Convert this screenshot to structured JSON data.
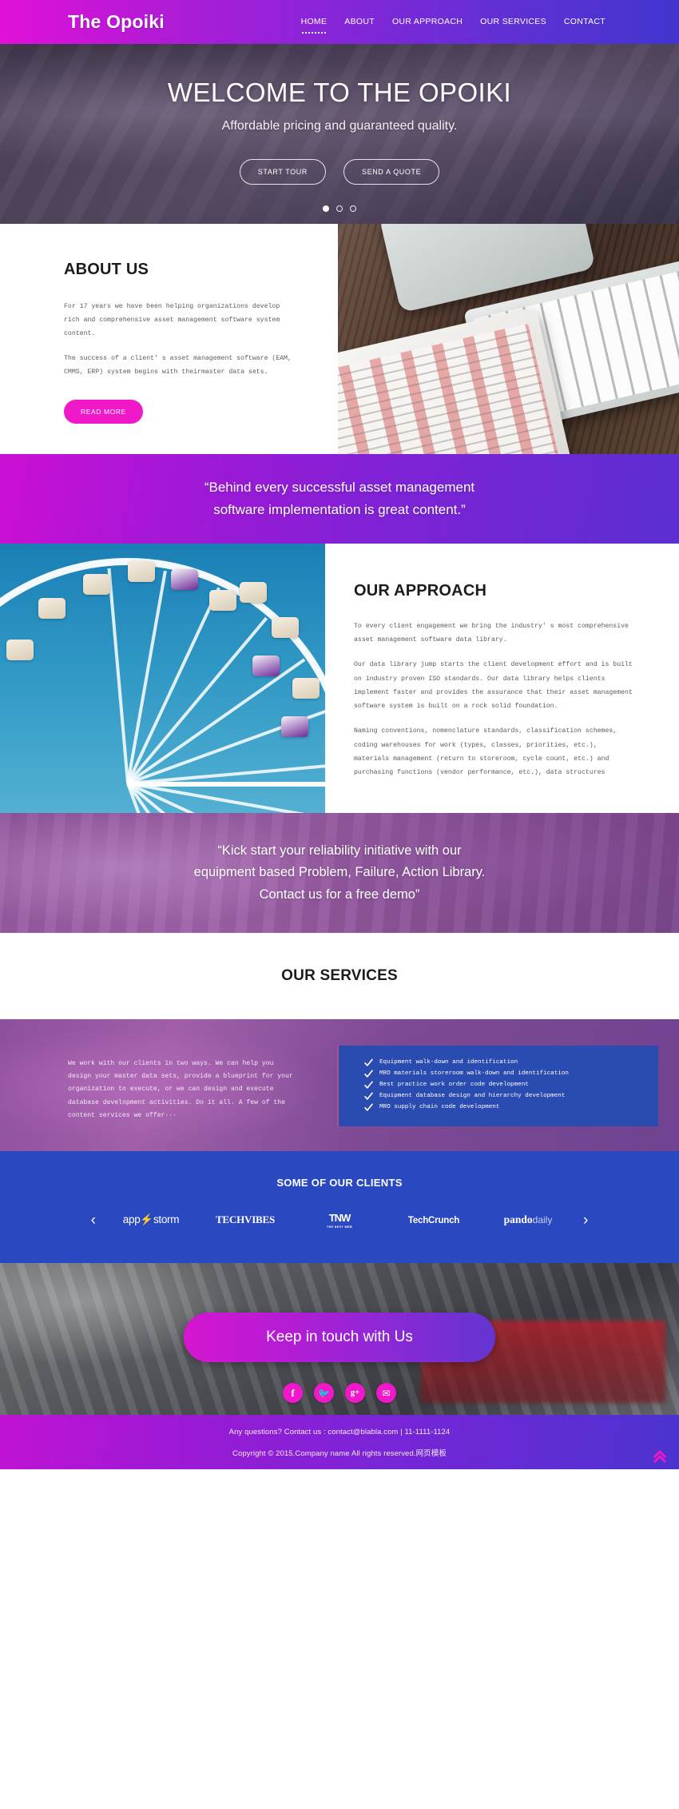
{
  "header": {
    "brand": "The Opoiki",
    "nav": [
      {
        "label": "HOME",
        "active": true
      },
      {
        "label": "ABOUT",
        "active": false
      },
      {
        "label": "OUR APPROACH",
        "active": false
      },
      {
        "label": "OUR SERVICES",
        "active": false
      },
      {
        "label": "CONTACT",
        "active": false
      }
    ]
  },
  "hero": {
    "title": "WELCOME TO THE OPOIKI",
    "subtitle": "Affordable pricing and guaranteed quality.",
    "primary_button": "START TOUR",
    "secondary_button": "SEND A QUOTE",
    "slides": 3,
    "active_slide": 1
  },
  "about": {
    "title": "ABOUT US",
    "paragraph1": "For 17 years we have been helping organizations develop rich and comprehensive asset management software system content.",
    "paragraph2": "The success of a client' s asset management software (EAM, CMMS, ERP) system begins with theirmaster data sets.",
    "button": "READ MORE",
    "image_alt": "desk-photo-keyboard-tablet-calendar"
  },
  "quote1": {
    "line1": "“Behind every successful asset management",
    "line2": "software implementation is great content.”"
  },
  "approach": {
    "title": "OUR APPROACH",
    "paragraph1": "To every client engagement we bring the industry' s most comprehensive asset management software data library.",
    "paragraph2": "Our data library jump starts the client development effort and is built on industry proven ISO standards. Our data library helps clients implement faster and provides the assurance that their asset management software system is built on a rock solid foundation.",
    "paragraph3": "Naming conventions, nomenclature standards, classification schemes, coding warehouses for work (types, classes, priorities, etc.), materials management (return to storeroom, cycle count, etc.) and purchasing functions (vendor performance, etc.), data structures",
    "image_alt": "ferris-wheel-photo"
  },
  "quote2": {
    "line1": "“Kick start your reliability initiative with our",
    "line2": "equipment based Problem, Failure, Action Library.",
    "line3": "Contact us for a free demo”"
  },
  "services": {
    "title": "OUR SERVICES",
    "intro": "We work with our clients in two ways. We can help you design your master data sets, provide a blueprint for your organization to execute, or we can design and execute database development activities. Do it all. A few of the content services we offer···",
    "checklist": [
      "Equipment walk-down and identification",
      "MRO materials storeroom walk-down and identification",
      "Best practice work order code development",
      "Equipment database design and hierarchy development",
      "MRO supply chain code development"
    ]
  },
  "clients": {
    "title": "SOME OF OUR CLIENTS",
    "prev_label": "‹",
    "next_label": "›",
    "logos": [
      {
        "name": "appstorm",
        "part1": "app",
        "bolt": "⚡",
        "part2": "storm"
      },
      {
        "name": "techvibes",
        "part1": "TECH",
        "part2": "VIBES"
      },
      {
        "name": "tnw",
        "part1": "TNW",
        "part2": "THE NEXT WEB"
      },
      {
        "name": "techcrunch",
        "part1": "TechCrunch",
        "part2": ""
      },
      {
        "name": "pandodaily",
        "part1": "pando",
        "part2": "daily"
      }
    ]
  },
  "contact": {
    "button": "Keep in touch with Us",
    "socials": [
      {
        "name": "facebook-icon",
        "glyph": "f"
      },
      {
        "name": "twitter-icon",
        "glyph": "🐦"
      },
      {
        "name": "google-plus-icon",
        "glyph": "g+"
      },
      {
        "name": "email-icon",
        "glyph": "✉"
      }
    ]
  },
  "footer": {
    "line1": "Any questions? Contact us : contact@blabla.com  |  11-1111-1124",
    "line2": "Copyright © 2015.Company name All rights reserved.网页模板",
    "to_top_label": "back-to-top"
  },
  "colors": {
    "magenta": "#ef19c9",
    "purple": "#8526d8",
    "indigo": "#4335cf",
    "clients_blue": "#2a48c0",
    "checkbox_blue": "#2a4bb0"
  }
}
